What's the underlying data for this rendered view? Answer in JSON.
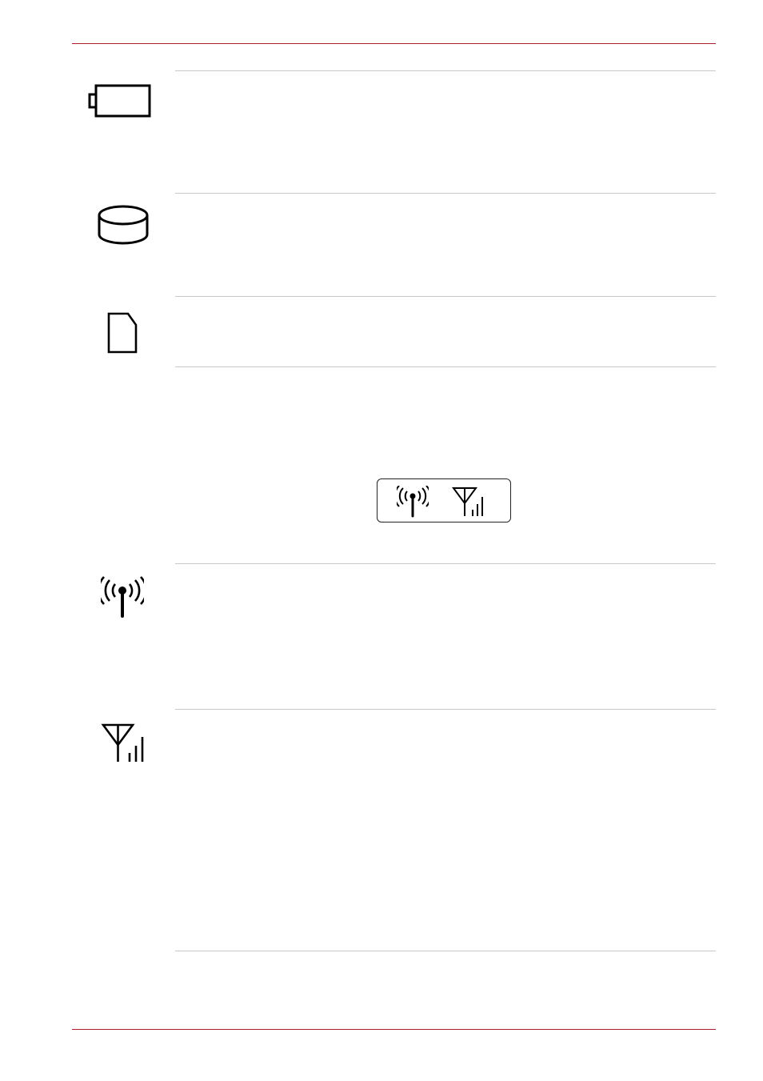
{
  "page": {
    "colors": {
      "rule_accent": "#b01c2e",
      "row_divider": "#c8c8c8",
      "icon_stroke": "#000000"
    },
    "rows": [
      {
        "icon": "battery-icon"
      },
      {
        "icon": "hard-disk-icon"
      },
      {
        "icon": "memory-card-icon"
      },
      {
        "icon": "wireless-lan-icon"
      },
      {
        "icon": "wireless-wan-icon"
      }
    ],
    "indicator_panel": {
      "icons": [
        "wireless-lan-icon",
        "wireless-wan-icon"
      ]
    }
  }
}
